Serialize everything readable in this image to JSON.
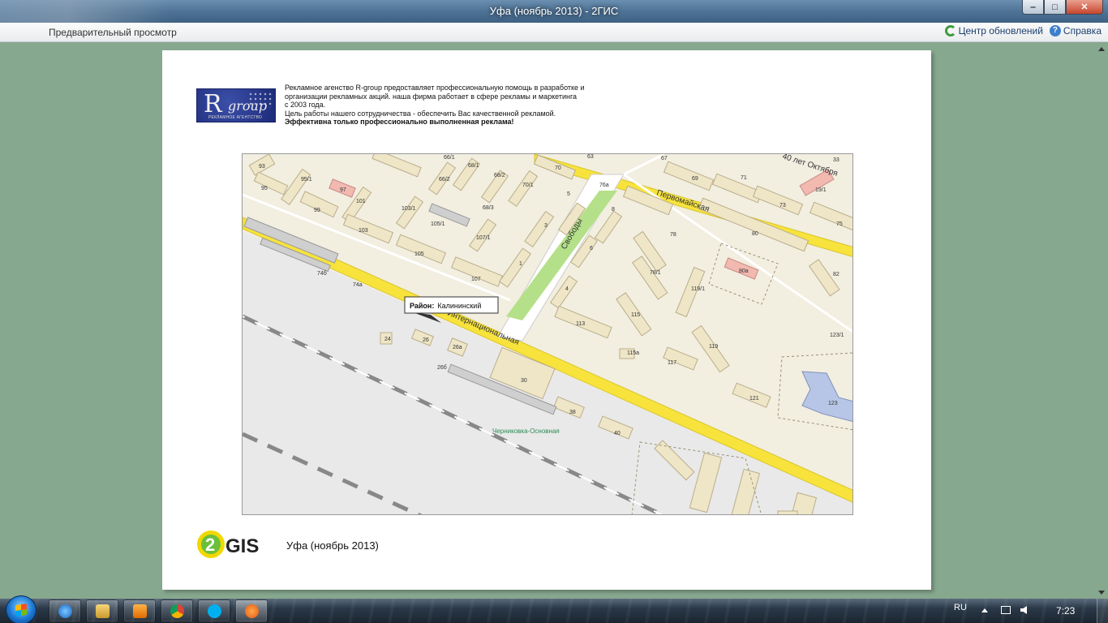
{
  "window": {
    "title": "Уфа (ноябрь 2013) - 2ГИС",
    "minimize": "‒",
    "maximize": "□",
    "close": "✕"
  },
  "toolbar": {
    "preview_label": "Предварительный просмотр",
    "update_center_label": "Центр обновлений",
    "help_label": "Справка"
  },
  "ad": {
    "logo_text": "R",
    "logo_sub": "group",
    "logo_caption": "РЕКЛАМНОЕ АГЕНТСТВО",
    "line1": "Рекламное агенство R-group предоставляет профессиональную помощь в разработке и",
    "line2": "организации рекламных акций. наша фирма работает в сфере рекламы и маркетинга",
    "line3": "с 2003 года.",
    "line4": "Цель работы нашего сотрудничества - обеспечить Вас качественной рекламой.",
    "line5": "Эффективна только профессионально выполненная реклама!"
  },
  "map": {
    "district_label": "Район:",
    "district_value": "Калининский",
    "streets": [
      "Интернациональная",
      "Свободы",
      "Первомайская",
      "40 лет Октября"
    ],
    "station": "Черниковка-Основная",
    "buildings": [
      "93",
      "95",
      "95/1",
      "97",
      "99",
      "101",
      "103",
      "103/1",
      "105/1",
      "105",
      "107",
      "107/1",
      "68/1",
      "68/2",
      "68/3",
      "66/2",
      "66/1",
      "70/1",
      "70",
      "3",
      "5",
      "1",
      "2",
      "4",
      "6",
      "8",
      "76а",
      "78",
      "78/1",
      "67",
      "69",
      "71",
      "73",
      "75",
      "80",
      "80а",
      "19/1",
      "33",
      "82",
      "119/1",
      "115",
      "113",
      "117",
      "115а",
      "119",
      "121",
      "123",
      "123/1",
      "74б",
      "74а",
      "24",
      "26",
      "26а",
      "26б",
      "30",
      "38",
      "40",
      "63"
    ]
  },
  "footer": {
    "gis_logo_text": "GIS",
    "gis_logo_num": "2",
    "caption": "Уфа (ноябрь 2013)"
  },
  "taskbar": {
    "lang": "RU",
    "time": "7:23",
    "apps": [
      "ie-icon",
      "explorer-icon",
      "media-player-icon",
      "chrome-icon",
      "skype-icon",
      "2gis-icon"
    ]
  },
  "colors": {
    "background": "#86a88e",
    "road_yellow": "#f7e33c",
    "park_green": "#b5e08a",
    "building": "#efe6c8"
  }
}
